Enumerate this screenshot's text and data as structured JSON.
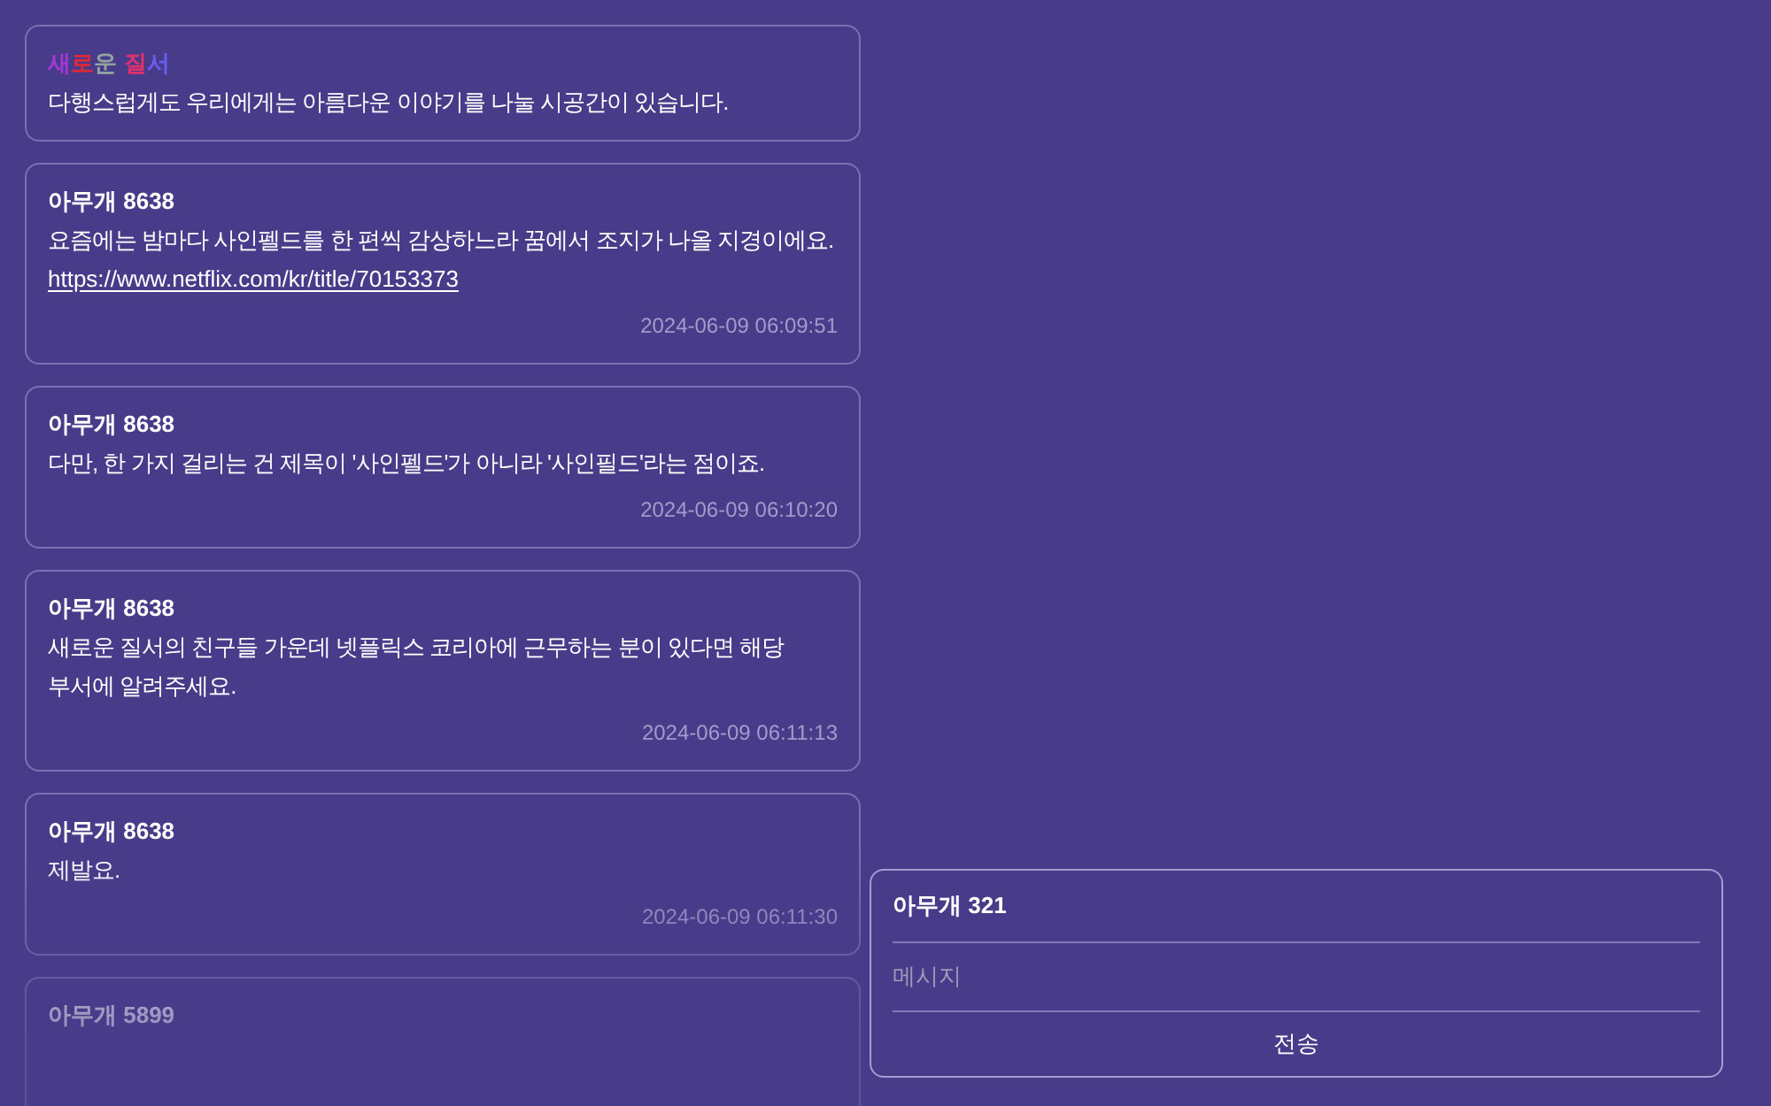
{
  "notice": {
    "title_words": [
      {
        "letters": [
          {
            "text": "새",
            "color": "#a238d8"
          },
          {
            "text": "로",
            "color": "#e02838"
          },
          {
            "text": "운",
            "color": "#95a39f"
          }
        ]
      },
      {
        "letters": [
          {
            "text": "질",
            "color": "#e0306e"
          },
          {
            "text": "서",
            "color": "#6a5cf0"
          }
        ]
      }
    ],
    "body": "다행스럽게도 우리에게는 아름다운 이야기를 나눌 시공간이 있습니다."
  },
  "messages": [
    {
      "author": "아무개 8638",
      "body": "요즘에는 밤마다 사인펠드를 한 편씩 감상하느라 꿈에서 조지가 나올 지경이에요.",
      "link": "https://www.netflix.com/kr/title/70153373",
      "time": "2024-06-09 06:09:51"
    },
    {
      "author": "아무개 8638",
      "body": "다만, 한 가지 걸리는 건 제목이 '사인펠드'가 아니라 '사인필드'라는 점이죠.",
      "time": "2024-06-09 06:10:20"
    },
    {
      "author": "아무개 8638",
      "body": "새로운 질서의 친구들 가운데 넷플릭스 코리아에 근무하는 분이 있다면 해당 부서에 알려주세요.",
      "time": "2024-06-09 06:11:13"
    },
    {
      "author": "아무개 8638",
      "body": "제발요.",
      "time": "2024-06-09 06:11:30"
    },
    {
      "author": "아무개 5899"
    }
  ],
  "compose": {
    "name": "아무개 321",
    "placeholder": "메시지",
    "button": "전송"
  }
}
